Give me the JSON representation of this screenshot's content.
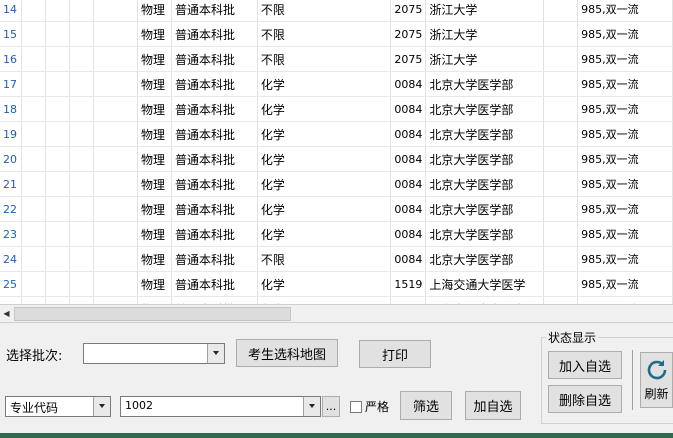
{
  "grid": {
    "rows": [
      {
        "no": "14",
        "subject": "物理",
        "batch": "普通本科批",
        "req": "不限",
        "code": "2075",
        "school": "浙江大学",
        "tag": "985,双一流"
      },
      {
        "no": "15",
        "subject": "物理",
        "batch": "普通本科批",
        "req": "不限",
        "code": "2075",
        "school": "浙江大学",
        "tag": "985,双一流"
      },
      {
        "no": "16",
        "subject": "物理",
        "batch": "普通本科批",
        "req": "不限",
        "code": "2075",
        "school": "浙江大学",
        "tag": "985,双一流"
      },
      {
        "no": "17",
        "subject": "物理",
        "batch": "普通本科批",
        "req": "化学",
        "code": "0084",
        "school": "北京大学医学部",
        "tag": "985,双一流"
      },
      {
        "no": "18",
        "subject": "物理",
        "batch": "普通本科批",
        "req": "化学",
        "code": "0084",
        "school": "北京大学医学部",
        "tag": "985,双一流"
      },
      {
        "no": "19",
        "subject": "物理",
        "batch": "普通本科批",
        "req": "化学",
        "code": "0084",
        "school": "北京大学医学部",
        "tag": "985,双一流"
      },
      {
        "no": "20",
        "subject": "物理",
        "batch": "普通本科批",
        "req": "化学",
        "code": "0084",
        "school": "北京大学医学部",
        "tag": "985,双一流"
      },
      {
        "no": "21",
        "subject": "物理",
        "batch": "普通本科批",
        "req": "化学",
        "code": "0084",
        "school": "北京大学医学部",
        "tag": "985,双一流"
      },
      {
        "no": "22",
        "subject": "物理",
        "batch": "普通本科批",
        "req": "化学",
        "code": "0084",
        "school": "北京大学医学部",
        "tag": "985,双一流"
      },
      {
        "no": "23",
        "subject": "物理",
        "batch": "普通本科批",
        "req": "化学",
        "code": "0084",
        "school": "北京大学医学部",
        "tag": "985,双一流"
      },
      {
        "no": "24",
        "subject": "物理",
        "batch": "普通本科批",
        "req": "不限",
        "code": "0084",
        "school": "北京大学医学部",
        "tag": "985,双一流"
      },
      {
        "no": "25",
        "subject": "物理",
        "batch": "普通本科批",
        "req": "化学",
        "code": "1519",
        "school": "上海交通大学医学",
        "tag": "985,双一流"
      }
    ],
    "partial_row": {
      "subject": "物理",
      "batch": "普通本科批",
      "req": "化学",
      "school": "上海交通大学医学",
      "tag": "985,双一流"
    }
  },
  "controls": {
    "batch_label": "选择批次:",
    "batch_value": "",
    "map_button": "考生选科地图",
    "print_button": "打印",
    "field_select": "专业代码",
    "field_value": "1002",
    "ellipsis_button": "...",
    "strict_label": "严格",
    "filter_button": "筛选",
    "add_fav_button": "加自选"
  },
  "status_group": {
    "title": "状态显示",
    "add_button": "加入自选",
    "remove_button": "删除自选",
    "refresh_label": "刷新"
  },
  "colors": {
    "row_number": "#1f5fb0",
    "bottom_strip": "#2f6b4d"
  }
}
